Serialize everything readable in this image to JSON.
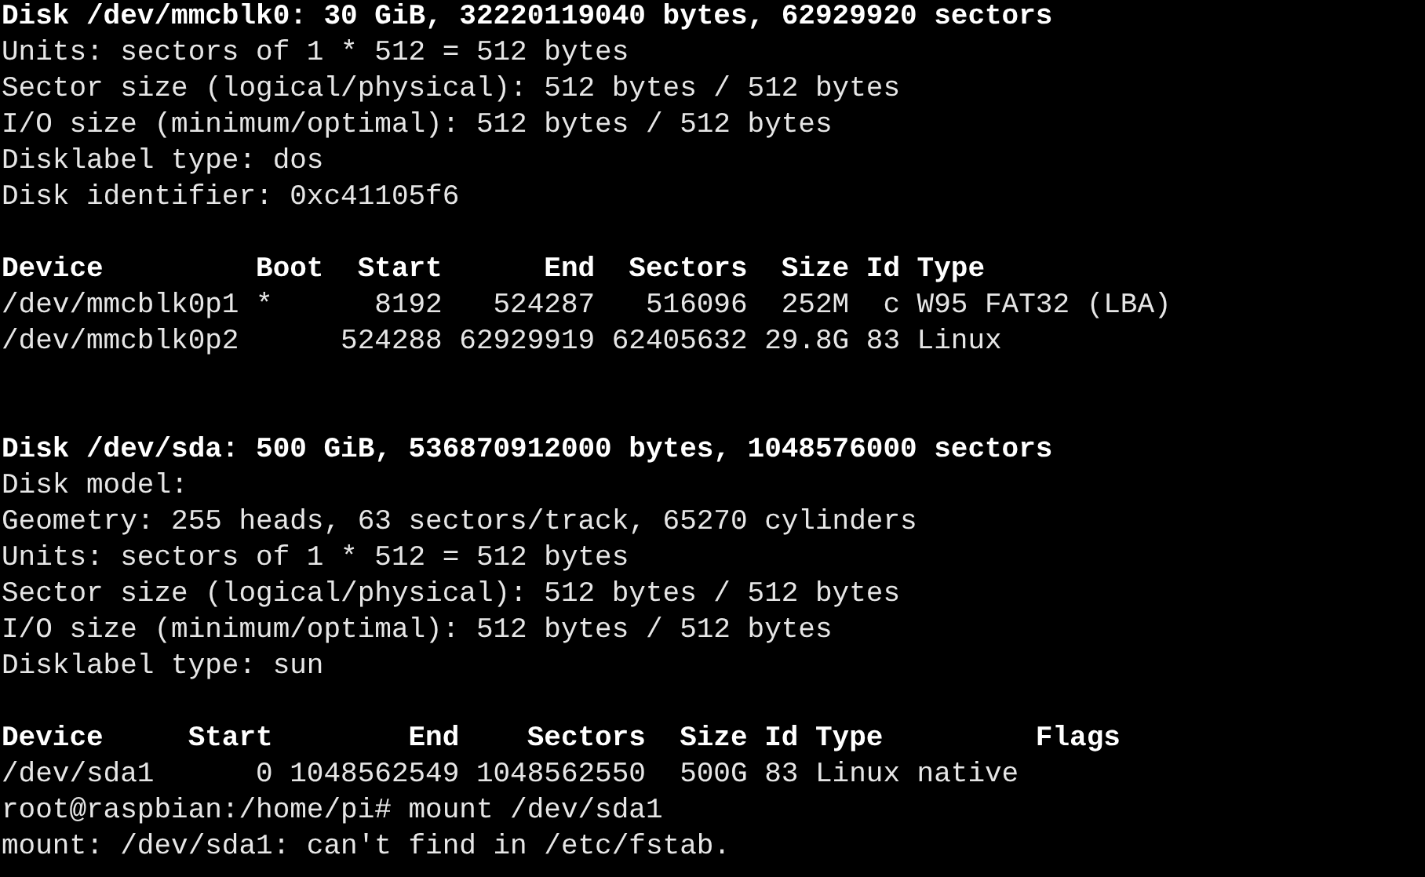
{
  "terminal": {
    "lines": [
      {
        "kind": "bold",
        "text": "Disk /dev/mmcblk0: 30 GiB, 32220119040 bytes, 62929920 sectors"
      },
      {
        "kind": "text",
        "text": "Units: sectors of 1 * 512 = 512 bytes"
      },
      {
        "kind": "text",
        "text": "Sector size (logical/physical): 512 bytes / 512 bytes"
      },
      {
        "kind": "text",
        "text": "I/O size (minimum/optimal): 512 bytes / 512 bytes"
      },
      {
        "kind": "text",
        "text": "Disklabel type: dos"
      },
      {
        "kind": "text",
        "text": "Disk identifier: 0xc41105f6"
      },
      {
        "kind": "gap"
      },
      {
        "kind": "bold",
        "text": "Device         Boot  Start      End  Sectors  Size Id Type"
      },
      {
        "kind": "text",
        "text": "/dev/mmcblk0p1 *      8192   524287   516096  252M  c W95 FAT32 (LBA)"
      },
      {
        "kind": "text",
        "text": "/dev/mmcblk0p2      524288 62929919 62405632 29.8G 83 Linux"
      },
      {
        "kind": "gap"
      },
      {
        "kind": "gap"
      },
      {
        "kind": "bold",
        "text": "Disk /dev/sda: 500 GiB, 536870912000 bytes, 1048576000 sectors"
      },
      {
        "kind": "text",
        "text": "Disk model:"
      },
      {
        "kind": "text",
        "text": "Geometry: 255 heads, 63 sectors/track, 65270 cylinders"
      },
      {
        "kind": "text",
        "text": "Units: sectors of 1 * 512 = 512 bytes"
      },
      {
        "kind": "text",
        "text": "Sector size (logical/physical): 512 bytes / 512 bytes"
      },
      {
        "kind": "text",
        "text": "I/O size (minimum/optimal): 512 bytes / 512 bytes"
      },
      {
        "kind": "text",
        "text": "Disklabel type: sun"
      },
      {
        "kind": "gap"
      },
      {
        "kind": "bold",
        "text": "Device     Start        End    Sectors  Size Id Type         Flags"
      },
      {
        "kind": "text",
        "text": "/dev/sda1      0 1048562549 1048562550  500G 83 Linux native"
      },
      {
        "kind": "text",
        "text": "root@raspbian:/home/pi# mount /dev/sda1"
      },
      {
        "kind": "text",
        "text": "mount: /dev/sda1: can't find in /etc/fstab."
      }
    ]
  }
}
